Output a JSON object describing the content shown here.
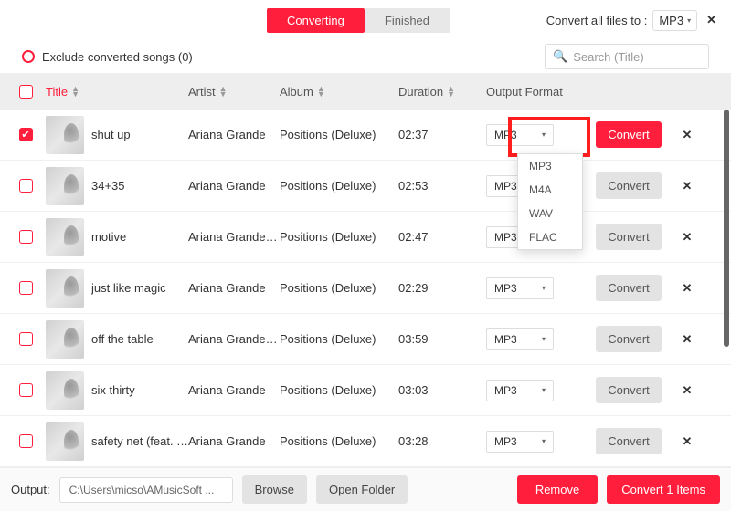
{
  "tabs": {
    "converting": "Converting",
    "finished": "Finished"
  },
  "convertAll": {
    "label": "Convert all files to :",
    "value": "MP3"
  },
  "exclude": {
    "label": "Exclude converted songs (0)"
  },
  "search": {
    "placeholder": "Search  (Title)"
  },
  "columns": {
    "title": "Title",
    "artist": "Artist",
    "album": "Album",
    "duration": "Duration",
    "format": "Output Format"
  },
  "formatOptions": [
    "MP3",
    "M4A",
    "WAV",
    "FLAC"
  ],
  "rows": [
    {
      "checked": true,
      "title": "shut up",
      "artist": "Ariana Grande",
      "album": "Positions (Deluxe)",
      "duration": "02:37",
      "format": "MP3",
      "primary": true
    },
    {
      "checked": false,
      "title": "34+35",
      "artist": "Ariana Grande",
      "album": "Positions (Deluxe)",
      "duration": "02:53",
      "format": "MP3",
      "primary": false
    },
    {
      "checked": false,
      "title": "motive",
      "artist": "Ariana Grande & ...",
      "album": "Positions (Deluxe)",
      "duration": "02:47",
      "format": "MP3",
      "primary": false
    },
    {
      "checked": false,
      "title": "just like magic",
      "artist": "Ariana Grande",
      "album": "Positions (Deluxe)",
      "duration": "02:29",
      "format": "MP3",
      "primary": false
    },
    {
      "checked": false,
      "title": "off the table",
      "artist": "Ariana Grande & ...",
      "album": "Positions (Deluxe)",
      "duration": "03:59",
      "format": "MP3",
      "primary": false
    },
    {
      "checked": false,
      "title": "six thirty",
      "artist": "Ariana Grande",
      "album": "Positions (Deluxe)",
      "duration": "03:03",
      "format": "MP3",
      "primary": false
    },
    {
      "checked": false,
      "title": "safety net (feat. Ty ...",
      "artist": "Ariana Grande",
      "album": "Positions (Deluxe)",
      "duration": "03:28",
      "format": "MP3",
      "primary": false
    }
  ],
  "buttons": {
    "convert": "Convert",
    "remove": "Remove",
    "convertItems": "Convert 1 Items",
    "browse": "Browse",
    "openFolder": "Open Folder"
  },
  "footer": {
    "outputLabel": "Output:",
    "path": "C:\\Users\\micso\\AMusicSoft ..."
  },
  "icons": {
    "x": "✕",
    "check": "✔",
    "caret": "▾",
    "search": "🔍"
  }
}
